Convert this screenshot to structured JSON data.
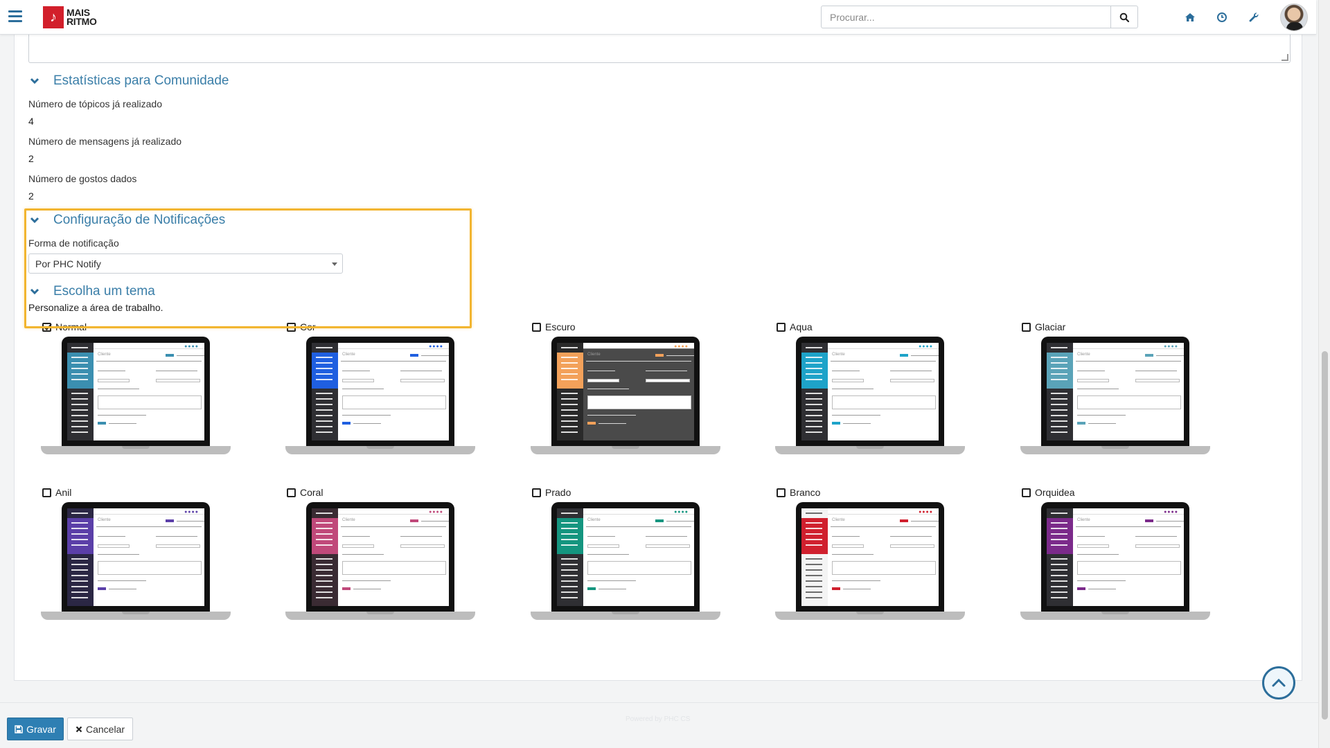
{
  "header": {
    "logo_line1": "MAIS",
    "logo_line2": "RITMO",
    "search_placeholder": "Procurar...",
    "accent": "#2c6e9b"
  },
  "sections": {
    "community_title": "Estatísticas para Comunidade",
    "topics_label": "Número de tópicos já realizado",
    "topics_value": "4",
    "messages_label": "Número de mensagens já realizado",
    "messages_value": "2",
    "likes_label": "Número de gostos dados",
    "likes_value": "2",
    "notif_title": "Configuração de Notificações",
    "notif_label": "Forma de notificação",
    "notif_value": "Por PHC Notify",
    "theme_title": "Escolha um tema",
    "theme_desc": "Personalize a área de trabalho."
  },
  "themes": [
    {
      "name": "Normal",
      "checked": true,
      "side": "#2f2f33",
      "accent": "#3b8fb0"
    },
    {
      "name": "Cor",
      "checked": false,
      "side": "#2f2f33",
      "accent": "#1f5fe0"
    },
    {
      "name": "Escuro",
      "checked": false,
      "side": "#2a2a2a",
      "accent": "#f3a15a"
    },
    {
      "name": "Aqua",
      "checked": false,
      "side": "#2f2f33",
      "accent": "#1ea3c9"
    },
    {
      "name": "Glaciar",
      "checked": false,
      "side": "#2f2f33",
      "accent": "#5aa3b8"
    },
    {
      "name": "Anil",
      "checked": false,
      "side": "#2b2744",
      "accent": "#5b3fa8"
    },
    {
      "name": "Coral",
      "checked": false,
      "side": "#3a2b33",
      "accent": "#c0497a"
    },
    {
      "name": "Prado",
      "checked": false,
      "side": "#2f2f33",
      "accent": "#14957f"
    },
    {
      "name": "Branco",
      "checked": false,
      "side": "#f4f4f4",
      "accent": "#d0202e"
    },
    {
      "name": "Orquidea",
      "checked": false,
      "side": "#2f2f33",
      "accent": "#7b2a8a"
    }
  ],
  "footer": {
    "save_label": "Gravar",
    "cancel_label": "Cancelar",
    "powered": "Powered by PHC CS"
  }
}
